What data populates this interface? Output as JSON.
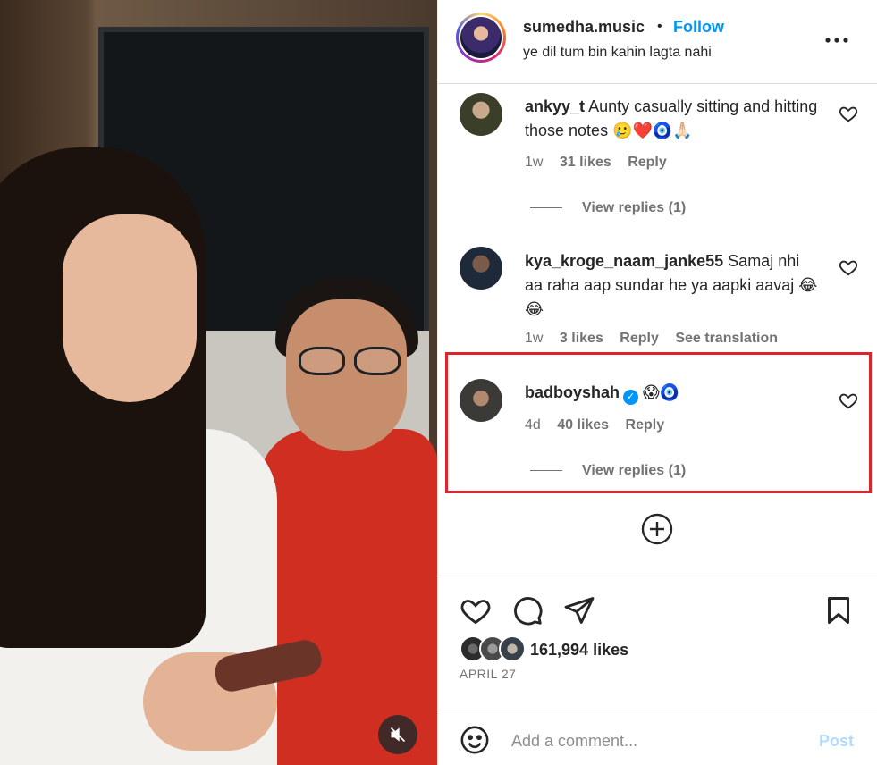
{
  "post": {
    "username": "sumedha.music",
    "separator": "•",
    "follow_label": "Follow",
    "subtitle": "ye dil tum bin kahin lagta nahi",
    "more_icon": "more-options-icon"
  },
  "comments": [
    {
      "username": "ankyy_t",
      "text": "Aunty casually sitting and hitting those notes 🥲❤️🧿🙏🏻",
      "time": "1w",
      "likes": "31 likes",
      "reply_label": "Reply",
      "view_replies": "View replies (1)"
    },
    {
      "username": "kya_kroge_naam_janke55",
      "text": "Samaj nhi aa raha aap sundar he ya aapki aavaj 😂😂",
      "time": "1w",
      "likes": "3 likes",
      "reply_label": "Reply",
      "translation_label": "See translation"
    },
    {
      "username": "badboyshah",
      "text": "😱🧿",
      "time": "4d",
      "likes": "40 likes",
      "reply_label": "Reply",
      "view_replies": "View replies (1)"
    }
  ],
  "engagement": {
    "likes_count": "161,994 likes",
    "date": "APRIL 27"
  },
  "composer": {
    "placeholder": "Add a comment...",
    "post_label": "Post"
  },
  "colors": {
    "accent": "#0095f6",
    "highlight": "#e0232a",
    "muted": "#737373"
  }
}
